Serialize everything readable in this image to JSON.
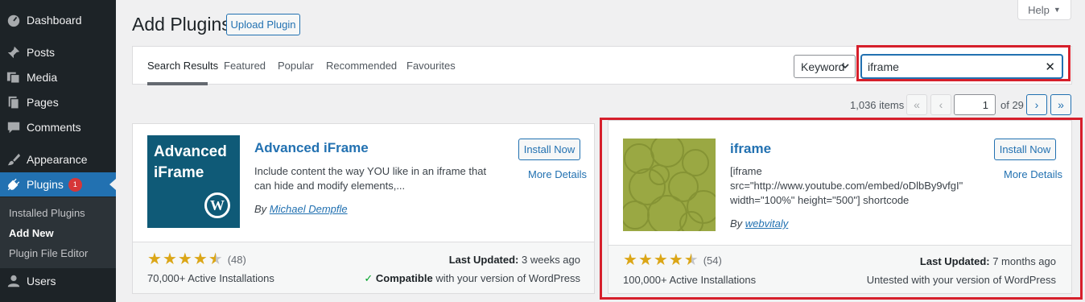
{
  "sidebar": {
    "items": [
      {
        "label": "Dashboard",
        "icon": "dashboard-icon"
      },
      {
        "label": "Posts",
        "icon": "pin-icon"
      },
      {
        "label": "Media",
        "icon": "media-icon"
      },
      {
        "label": "Pages",
        "icon": "pages-icon"
      },
      {
        "label": "Comments",
        "icon": "comment-icon"
      },
      {
        "label": "Appearance",
        "icon": "brush-icon"
      },
      {
        "label": "Plugins",
        "icon": "plug-icon",
        "badge": "1"
      },
      {
        "label": "Users",
        "icon": "user-icon"
      }
    ],
    "submenu": [
      "Installed Plugins",
      "Add New",
      "Plugin File Editor"
    ]
  },
  "header": {
    "title": "Add Plugins",
    "upload_label": "Upload Plugin",
    "help_label": "Help"
  },
  "filter": {
    "tabs": [
      "Search Results",
      "Featured",
      "Popular",
      "Recommended",
      "Favourites"
    ],
    "search_type": "Keyword",
    "search_value": "iframe"
  },
  "pagination": {
    "items": "1,036 items",
    "first": "«",
    "prev": "‹",
    "current": "1",
    "of_total": "of 29",
    "next": "›",
    "last": "»"
  },
  "plugins": [
    {
      "name": "Advanced iFrame",
      "thumb_text_1": "Advanced",
      "thumb_text_2": "iFrame",
      "description": "Include content the way YOU like in an iframe that can hide and modify elements,...",
      "by": "By",
      "author": "Michael Dempfle",
      "install": "Install Now",
      "more": "More Details",
      "rating_count": "(48)",
      "active_installs": "70,000+ Active Installations",
      "last_updated_label": "Last Updated:",
      "last_updated": "3 weeks ago",
      "compat_check": "✓",
      "compat_bold": "Compatible",
      "compat_rest": "with your version of WordPress",
      "rating": 4.5
    },
    {
      "name": "iframe",
      "description": "[iframe src=\"http://www.youtube.com/embed/oDlbBy9vfgI\" width=\"100%\" height=\"500\"] shortcode",
      "by": "By",
      "author": "webvitaly",
      "install": "Install Now",
      "more": "More Details",
      "rating_count": "(54)",
      "active_installs": "100,000+ Active Installations",
      "last_updated_label": "Last Updated:",
      "last_updated": "7 months ago",
      "compat_text": "Untested with your version of WordPress",
      "rating": 4.5
    }
  ],
  "colors": {
    "accent": "#2271b1",
    "highlight": "#d61f2b",
    "star": "#dba617",
    "sidebar": "#1d2327"
  }
}
